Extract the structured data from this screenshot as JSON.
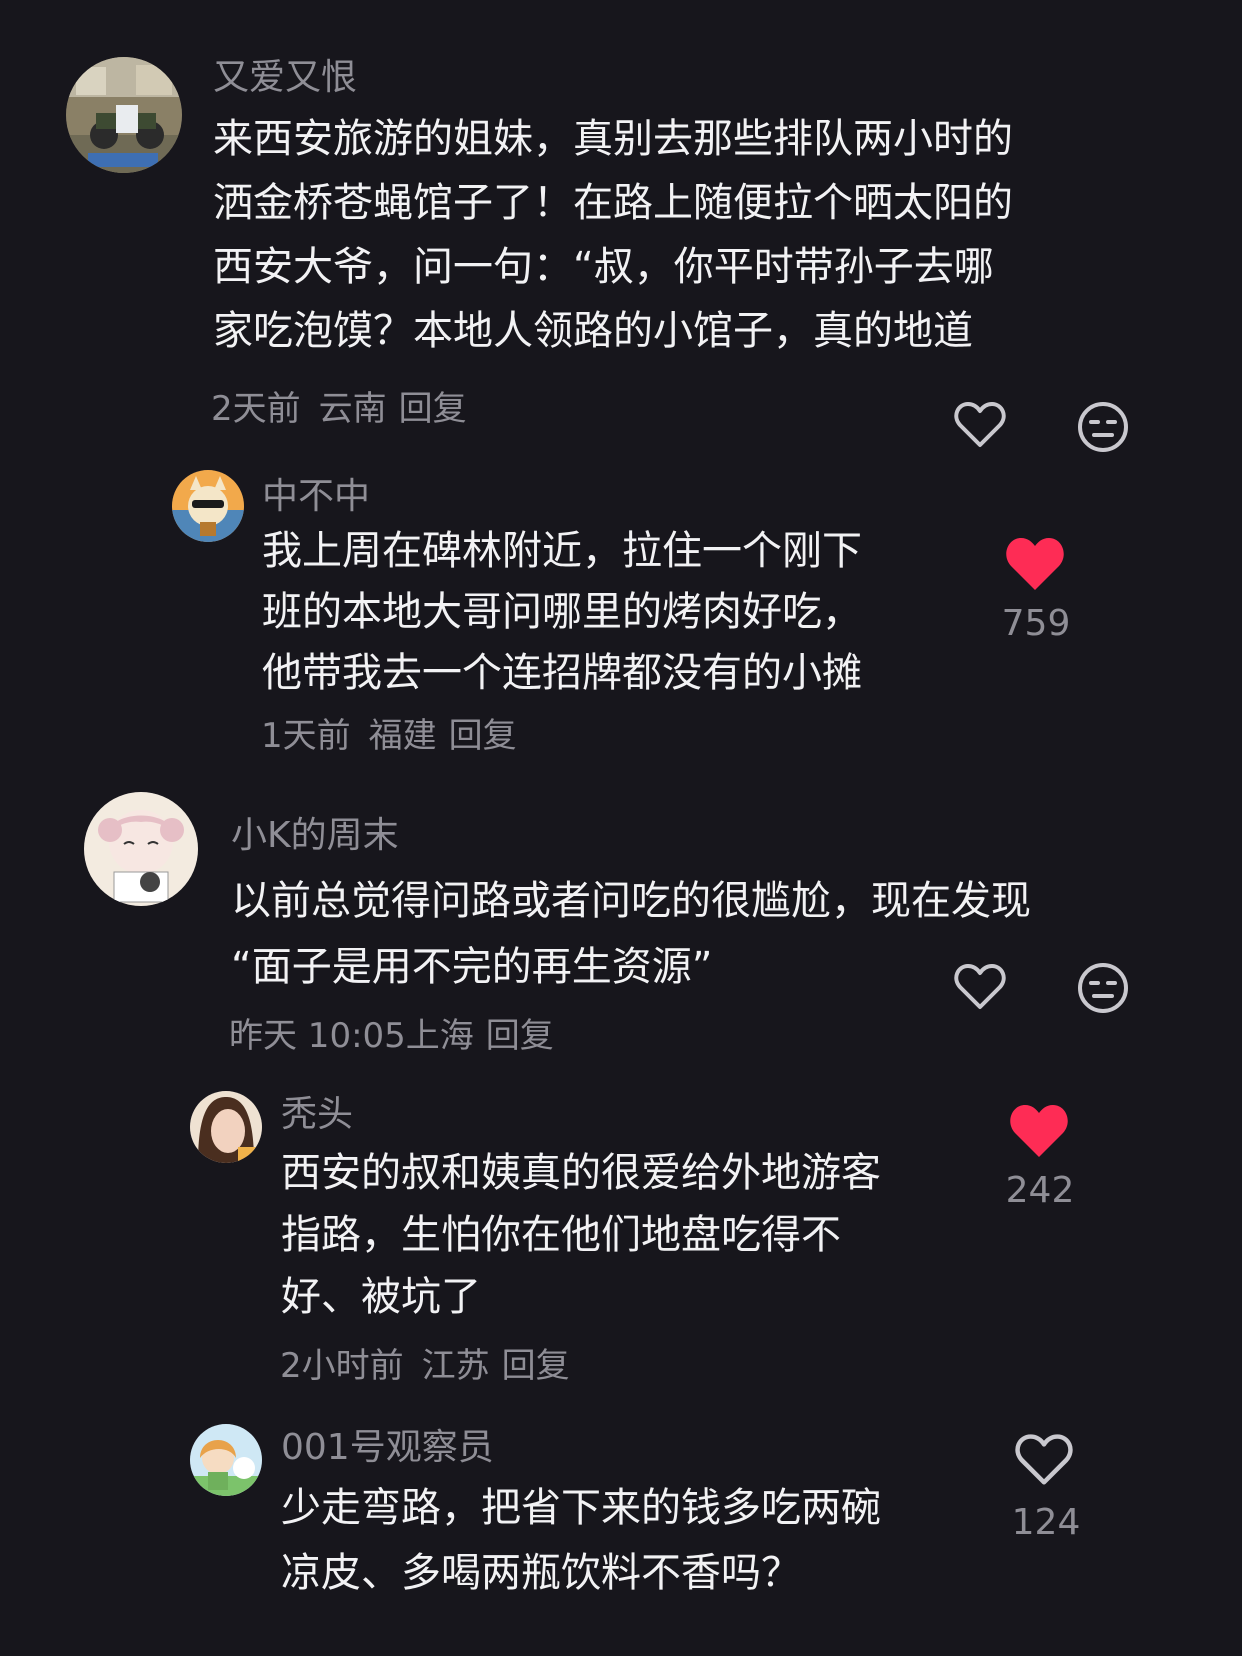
{
  "comments": [
    {
      "user": "又爱又恨",
      "lines": [
        "来西安旅游的姐妹，真别去那些排队两小时的",
        "洒金桥苍蝇馆子了！在路上随便拉个晒太阳的",
        "西安大爷，问一句：“叔，你平时带孙子去哪",
        "家吃泡馍？本地人领路的小馆子，真的地道"
      ],
      "time": "2天前",
      "location": "云南",
      "reply": "回复",
      "like_icon": "heart-outline-icon",
      "dislike_icon": "meh-face-icon"
    },
    {
      "user": "中不中",
      "lines": [
        "我上周在碑林附近，拉住一个刚下",
        "班的本地大哥问哪里的烤肉好吃，",
        "他带我去一个连招牌都没有的小摊"
      ],
      "time": "1天前",
      "location": "福建",
      "reply": "回复",
      "likes": "759",
      "like_icon": "heart-filled-icon"
    },
    {
      "user": "小K的周末",
      "lines": [
        "以前总觉得问路或者问吃的很尴尬，现在发现",
        "“面子是用不完的再生资源”"
      ],
      "time": "昨天 10:05",
      "location": "上海",
      "reply": "回复",
      "like_icon": "heart-outline-icon",
      "dislike_icon": "meh-face-icon"
    },
    {
      "user": "秃头",
      "lines": [
        "西安的叔和姨真的很爱给外地游客",
        "指路，生怕你在他们地盘吃得不",
        "好、被坑了"
      ],
      "time": "2小时前",
      "location": "江苏",
      "reply": "回复",
      "likes": "242",
      "like_icon": "heart-filled-icon"
    },
    {
      "user": "001号观察员",
      "lines": [
        "少走弯路，把省下来的钱多吃两碗",
        "凉皮、多喝两瓶饮料不香吗？"
      ],
      "likes": "124",
      "like_icon": "heart-outline-icon"
    }
  ],
  "colors": {
    "background": "#17161c",
    "like_red": "#fe2c55",
    "muted_text": "#8f8e96"
  }
}
